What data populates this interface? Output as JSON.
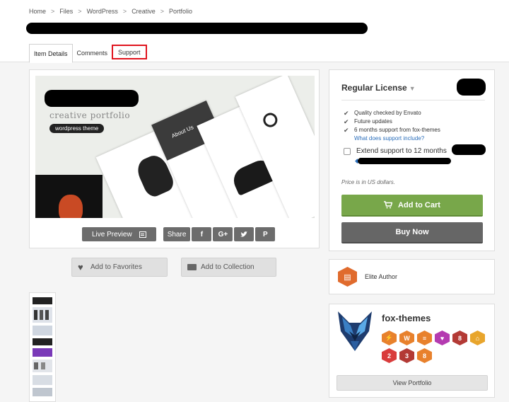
{
  "breadcrumb": [
    "Home",
    "Files",
    "WordPress",
    "Creative",
    "Portfolio"
  ],
  "tabs": [
    {
      "label": "Item Details"
    },
    {
      "label": "Comments"
    },
    {
      "label": "Support"
    }
  ],
  "preview": {
    "tagline": "creative portfolio",
    "chip": "wordpress theme",
    "about": "About Us"
  },
  "actions": {
    "live_preview": "Live Preview",
    "share": "Share",
    "share_buttons": [
      "f",
      "G+",
      "t",
      "P"
    ]
  },
  "secondary": {
    "favorites": "Add to Favorites",
    "collection": "Add to Collection"
  },
  "purchase": {
    "license": "Regular License",
    "features": [
      "Quality checked by Envato",
      "Future updates",
      "6 months support from fox-themes"
    ],
    "support_link": "What does support include?",
    "extend": "Extend support to 12 months",
    "price_note": "Price is in US dollars.",
    "cart": "Add to Cart",
    "buy": "Buy Now"
  },
  "elite": {
    "label": "Elite Author"
  },
  "author": {
    "name": "fox-themes",
    "view_portfolio": "View Portfolio",
    "badges": [
      {
        "icon": "bolt-icon",
        "color": "#e8812c",
        "text": ""
      },
      {
        "icon": "rocket-icon",
        "color": "#e8812c",
        "text": "W"
      },
      {
        "icon": "stack-icon",
        "color": "#e8812c",
        "text": ""
      },
      {
        "icon": "heart-badge-icon",
        "color": "#b43bb0",
        "text": ""
      },
      {
        "icon": "paw-icon",
        "color": "#b33a35",
        "text": "8"
      },
      {
        "icon": "cart-badge-icon",
        "color": "#e8a52c",
        "text": ""
      },
      {
        "icon": "link-icon",
        "color": "#d93c3c",
        "text": "2"
      },
      {
        "icon": "dots-icon",
        "color": "#b33a35",
        "text": "3"
      },
      {
        "icon": "award-icon",
        "color": "#e8812c",
        "text": "8"
      }
    ]
  },
  "colors": {
    "accent_green": "#78a74a",
    "highlight_red": "#e0141e",
    "link_blue": "#2a6ebb"
  }
}
